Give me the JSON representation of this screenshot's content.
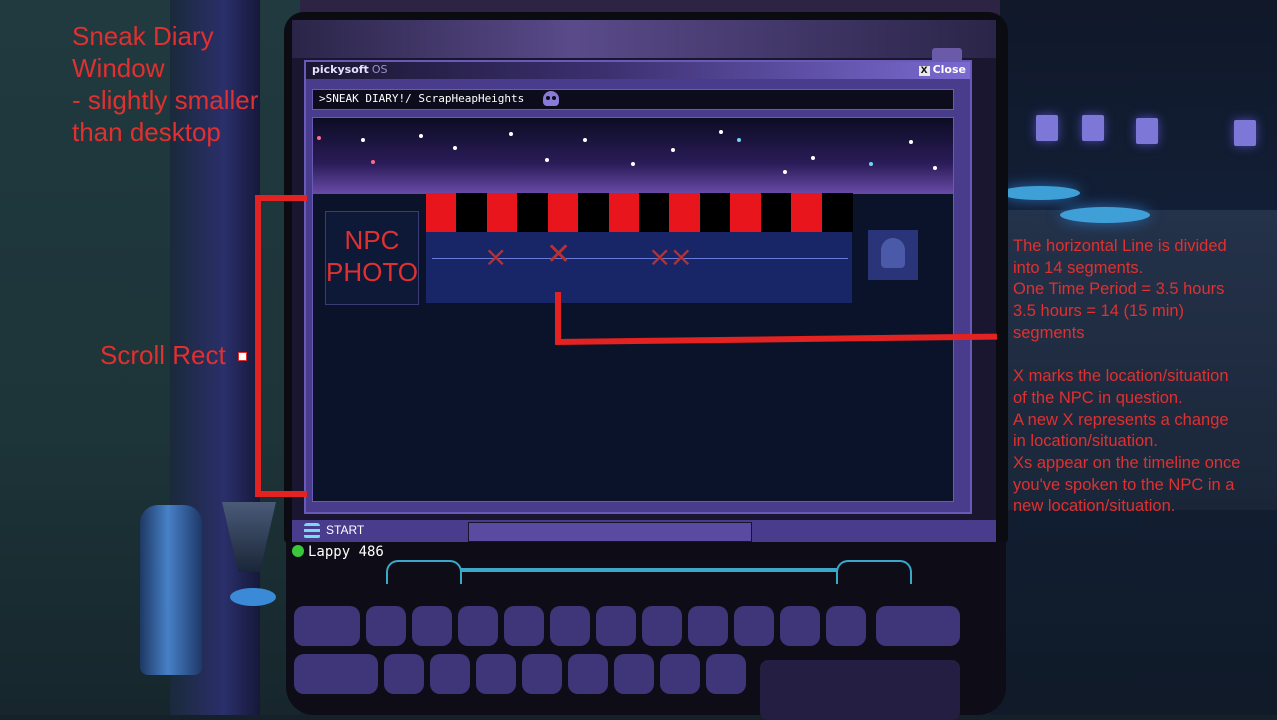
{
  "annotations": {
    "title_lines": [
      "Sneak Diary",
      "Window",
      "- slightly smaller",
      "than desktop"
    ],
    "scroll_rect_label": "Scroll Rect",
    "notes_block1": [
      "The horizontal Line is divided",
      "into 14 segments.",
      "One Time Period = 3.5 hours",
      "3.5 hours = 14 (15 min)",
      "segments"
    ],
    "notes_block2": [
      "X marks the location/situation",
      "of the NPC in question.",
      "A new X represents a change",
      "in location/situation.",
      "Xs appear on the timeline once",
      "you've spoken to the NPC in a",
      "new location/situation."
    ],
    "accent_color": "#e32222"
  },
  "window": {
    "brand": "pickysoft",
    "brand_suffix": "OS",
    "close_label": "Close",
    "close_icon": "X",
    "address": ">SNEAK DIARY!/ ScrapHeapHeights",
    "address_icon": "skull-icon"
  },
  "diary": {
    "npc_photo_lines": [
      "NPC",
      "PHOTO"
    ],
    "segment_count": 14,
    "segment_colors": [
      "#e8161c",
      "#000000"
    ],
    "x_marks": [
      "×",
      "✕",
      "××"
    ],
    "badge_icon": "ribbon-badge-icon"
  },
  "taskbar": {
    "start_label": "START",
    "start_icon": "menu-lines-icon"
  },
  "device": {
    "name": "Lappy 486",
    "status_color": "#3ac83a"
  }
}
